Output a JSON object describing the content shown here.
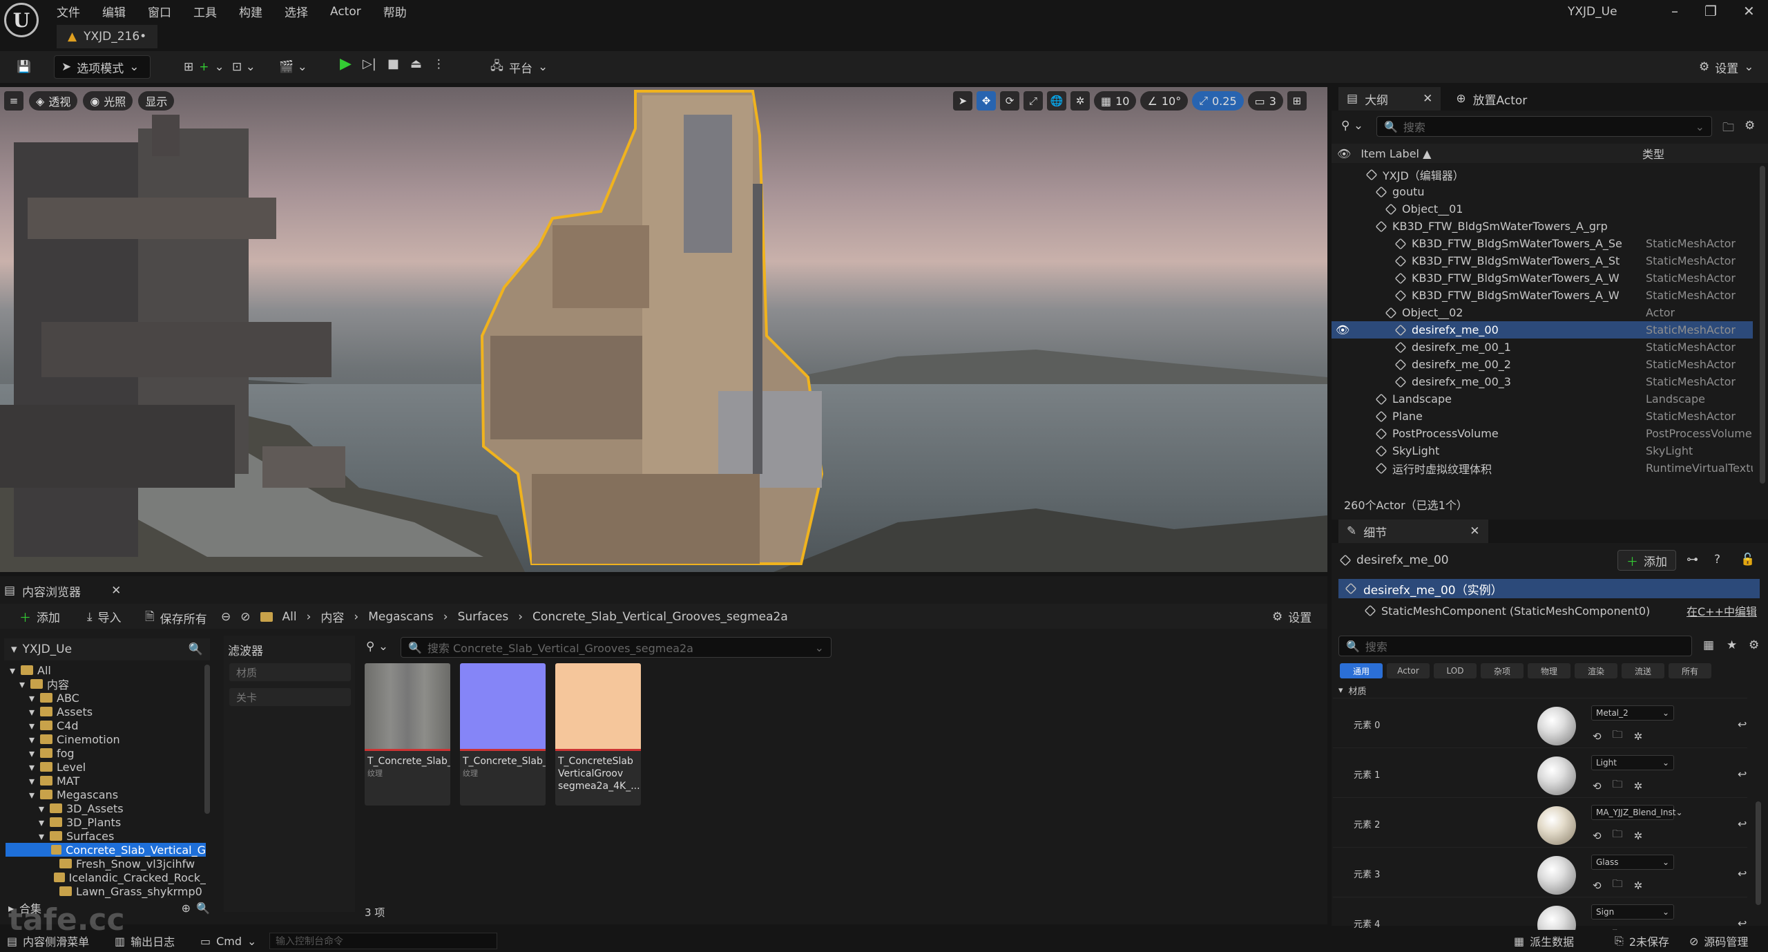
{
  "app": {
    "logo": "U",
    "menu": [
      "文件",
      "编辑",
      "窗口",
      "工具",
      "构建",
      "选择",
      "Actor",
      "帮助"
    ],
    "window_title": "YXJD_Ue",
    "doc_tab": "YXJD_216•"
  },
  "toolbar": {
    "mode_label": "选项模式",
    "platform_label": "平台",
    "settings_label": "设置"
  },
  "viewport": {
    "left_chips": [
      "透视",
      "光照",
      "显示"
    ],
    "grid_value": "10",
    "angle_value": "10°",
    "scale_value": "0.25",
    "camera_speed": "3"
  },
  "outliner": {
    "tab1": "大纲",
    "tab2": "放置Actor",
    "search_placeholder": "搜索",
    "col_label": "Item Label ▲",
    "col_type": "类型",
    "rows": [
      {
        "label": "YXJD（编辑器）",
        "type": "",
        "indent": 0
      },
      {
        "label": "goutu",
        "type": "",
        "indent": 1
      },
      {
        "label": "Object__01",
        "type": "",
        "indent": 2
      },
      {
        "label": "KB3D_FTW_BldgSmWaterTowers_A_grp",
        "type": "",
        "indent": 1
      },
      {
        "label": "KB3D_FTW_BldgSmWaterTowers_A_Se",
        "type": "StaticMeshActor",
        "indent": 3
      },
      {
        "label": "KB3D_FTW_BldgSmWaterTowers_A_St",
        "type": "StaticMeshActor",
        "indent": 3
      },
      {
        "label": "KB3D_FTW_BldgSmWaterTowers_A_W",
        "type": "StaticMeshActor",
        "indent": 3
      },
      {
        "label": "KB3D_FTW_BldgSmWaterTowers_A_W",
        "type": "StaticMeshActor",
        "indent": 3
      },
      {
        "label": "Object__02",
        "type": "Actor",
        "indent": 2
      },
      {
        "label": "desirefx_me_00",
        "type": "StaticMeshActor",
        "indent": 3,
        "sel": true
      },
      {
        "label": "desirefx_me_00_1",
        "type": "StaticMeshActor",
        "indent": 3
      },
      {
        "label": "desirefx_me_00_2",
        "type": "StaticMeshActor",
        "indent": 3
      },
      {
        "label": "desirefx_me_00_3",
        "type": "StaticMeshActor",
        "indent": 3
      },
      {
        "label": "Landscape",
        "type": "Landscape",
        "indent": 1
      },
      {
        "label": "Plane",
        "type": "StaticMeshActor",
        "indent": 1
      },
      {
        "label": "PostProcessVolume",
        "type": "PostProcessVolume",
        "indent": 1
      },
      {
        "label": "SkyLight",
        "type": "SkyLight",
        "indent": 1
      },
      {
        "label": "运行时虚拟纹理体积",
        "type": "RuntimeVirtualTextu",
        "indent": 1
      }
    ],
    "count": "260个Actor（已选1个）"
  },
  "details": {
    "tab": "细节",
    "object": "desirefx_me_00",
    "add": "添加",
    "instance": "desirefx_me_00（实例）",
    "component": "StaticMeshComponent (StaticMeshComponent0)",
    "cpp_link": "在C++中编辑",
    "search_placeholder": "搜索",
    "categories": [
      "通用",
      "Actor",
      "LOD",
      "杂项",
      "物理",
      "渲染",
      "流送",
      "所有"
    ],
    "section": "材质",
    "materials": [
      {
        "slot": "元素 0",
        "mat": "Metal_2"
      },
      {
        "slot": "元素 1",
        "mat": "Light"
      },
      {
        "slot": "元素 2",
        "mat": "MA_YJJZ_Blend_Inst"
      },
      {
        "slot": "元素 3",
        "mat": "Glass"
      },
      {
        "slot": "元素 4",
        "mat": "Sign"
      }
    ]
  },
  "content_browser": {
    "tab": "内容浏览器",
    "add": "添加",
    "import": "导入",
    "save_all": "保存所有",
    "breadcrumb": [
      "All",
      "内容",
      "Megascans",
      "Surfaces",
      "Concrete_Slab_Vertical_Grooves_segmea2a"
    ],
    "settings": "设置",
    "tree_root": "YXJD_Ue",
    "tree": [
      {
        "label": "All",
        "indent": 0
      },
      {
        "label": "内容",
        "indent": 1
      },
      {
        "label": "ABC",
        "indent": 2
      },
      {
        "label": "Assets",
        "indent": 2
      },
      {
        "label": "C4d",
        "indent": 2
      },
      {
        "label": "Cinemotion",
        "indent": 2
      },
      {
        "label": "fog",
        "indent": 2
      },
      {
        "label": "Level",
        "indent": 2
      },
      {
        "label": "MAT",
        "indent": 2
      },
      {
        "label": "Megascans",
        "indent": 2
      },
      {
        "label": "3D_Assets",
        "indent": 3
      },
      {
        "label": "3D_Plants",
        "indent": 3
      },
      {
        "label": "Surfaces",
        "indent": 3
      },
      {
        "label": "Concrete_Slab_Vertical_G",
        "indent": 4,
        "sel": true
      },
      {
        "label": "Fresh_Snow_vl3jcihfw",
        "indent": 4
      },
      {
        "label": "Icelandic_Cracked_Rock_",
        "indent": 4
      },
      {
        "label": "Lawn_Grass_shykrmp0",
        "indent": 4
      }
    ],
    "collections": "合集",
    "filter_title": "滤波器",
    "filters": [
      "材质",
      "关卡"
    ],
    "search_placeholder": "搜索 Concrete_Slab_Vertical_Grooves_segmea2a",
    "assets": [
      {
        "name": "T_Concrete_Slab_Vertical_Grooves_...",
        "kind": "纹理",
        "color": "#7b7b78"
      },
      {
        "name": "T_Concrete_Slab_Vertical_Grooves_...",
        "kind": "纹理",
        "color": "#8585f7"
      },
      {
        "name": "T_ConcreteSlab VerticalGroov segmea2a_4K_...",
        "kind": "",
        "color": "#f5c69b"
      }
    ],
    "item_count": "3 项"
  },
  "status": {
    "drawer": "内容侧滑菜单",
    "log": "输出日志",
    "cmd": "Cmd",
    "cmd_placeholder": "输入控制台命令",
    "derived": "派生数据",
    "unsaved": "2未保存",
    "source": "源码管理"
  },
  "watermark": "tafe.cc",
  "colors": {
    "accent": "#2b6fd6",
    "selection": "#2c4a7a",
    "folder": "#c8a24a"
  }
}
